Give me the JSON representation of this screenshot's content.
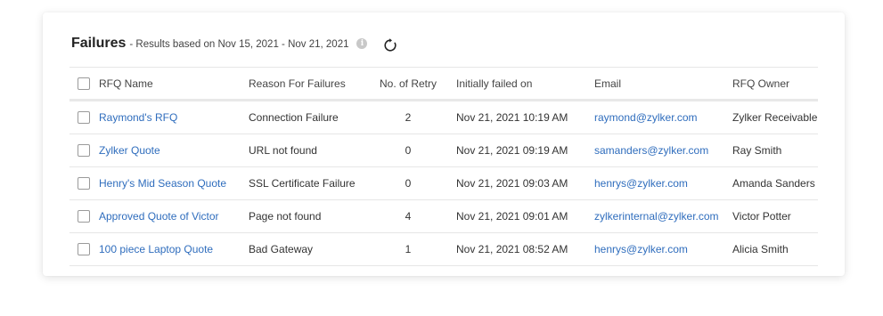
{
  "header": {
    "title": "Failures",
    "subtitle": "- Results based on Nov 15, 2021 - Nov 21, 2021",
    "info_icon": "info-icon",
    "refresh_icon": "refresh-icon"
  },
  "table": {
    "columns": {
      "name": "RFQ Name",
      "reason": "Reason For Failures",
      "retry": "No. of Retry",
      "failed_on": "Initially failed on",
      "email": "Email",
      "owner": "RFQ Owner"
    },
    "rows": [
      {
        "name": "Raymond's RFQ",
        "reason": "Connection Failure",
        "retry": "2",
        "failed_on": "Nov 21, 2021 10:19 AM",
        "email": "raymond@zylker.com",
        "owner": "Zylker Receivable"
      },
      {
        "name": "Zylker Quote",
        "reason": "URL not found",
        "retry": "0",
        "failed_on": "Nov 21, 2021 09:19 AM",
        "email": "samanders@zylker.com",
        "owner": "Ray Smith"
      },
      {
        "name": "Henry's Mid Season Quote",
        "reason": "SSL Certificate Failure",
        "retry": "0",
        "failed_on": "Nov 21, 2021 09:03 AM",
        "email": "henrys@zylker.com",
        "owner": "Amanda Sanders"
      },
      {
        "name": "Approved Quote of Victor",
        "reason": "Page not found",
        "retry": "4",
        "failed_on": "Nov 21, 2021 09:01 AM",
        "email": "zylkerinternal@zylker.com",
        "owner": "Victor Potter"
      },
      {
        "name": "100 piece Laptop Quote",
        "reason": "Bad Gateway",
        "retry": "1",
        "failed_on": "Nov 21, 2021 08:52 AM",
        "email": "henrys@zylker.com",
        "owner": "Alicia Smith"
      }
    ]
  },
  "colors": {
    "link": "#2f6dbd",
    "text": "#333333",
    "border": "#e6e6e6"
  }
}
